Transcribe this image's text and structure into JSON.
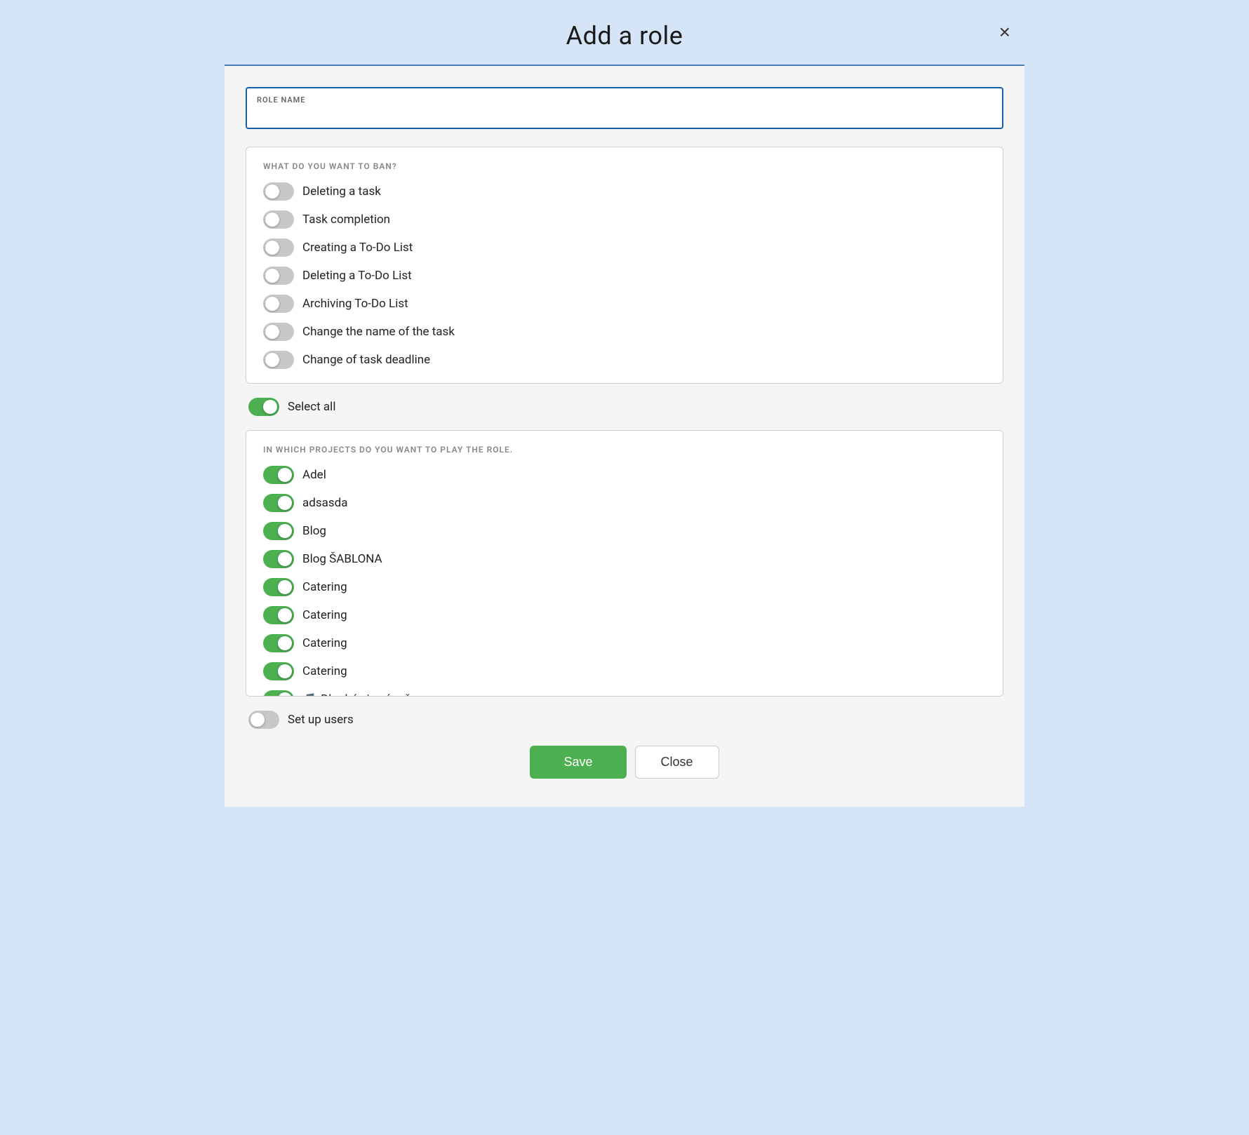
{
  "modal": {
    "title": "Add a role",
    "close_label": "×"
  },
  "role_name": {
    "label": "ROLE NAME",
    "placeholder": "",
    "value": ""
  },
  "ban_section": {
    "title": "WHAT DO YOU WANT TO BAN?",
    "items": [
      {
        "id": "deleting-task",
        "label": "Deleting a task",
        "on": false
      },
      {
        "id": "task-completion",
        "label": "Task completion",
        "on": false
      },
      {
        "id": "creating-todolist",
        "label": "Creating a To-Do List",
        "on": false
      },
      {
        "id": "deleting-todolist",
        "label": "Deleting a To-Do List",
        "on": false
      },
      {
        "id": "archiving-todolist",
        "label": "Archiving To-Do List",
        "on": false
      },
      {
        "id": "change-task-name",
        "label": "Change the name of the task",
        "on": false
      },
      {
        "id": "change-task-deadline",
        "label": "Change of task deadline",
        "on": false
      }
    ]
  },
  "select_all": {
    "label": "Select all",
    "on": true
  },
  "projects_section": {
    "title": "IN WHICH PROJECTS DO YOU WANT TO PLAY THE ROLE.",
    "items": [
      {
        "id": "adel",
        "label": "Adel",
        "on": true,
        "emoji": ""
      },
      {
        "id": "adsasda",
        "label": "adsasda",
        "on": true,
        "emoji": ""
      },
      {
        "id": "blog",
        "label": "Blog",
        "on": true,
        "emoji": ""
      },
      {
        "id": "blog-sablona",
        "label": "Blog ŠABLONA",
        "on": true,
        "emoji": ""
      },
      {
        "id": "catering-1",
        "label": "Catering",
        "on": true,
        "emoji": ""
      },
      {
        "id": "catering-2",
        "label": "Catering",
        "on": true,
        "emoji": ""
      },
      {
        "id": "catering-3",
        "label": "Catering",
        "on": true,
        "emoji": ""
      },
      {
        "id": "catering-4",
        "label": "Catering",
        "on": true,
        "emoji": ""
      },
      {
        "id": "dlouhe-zimni-vecery",
        "label": "Dlouhé zimní večery",
        "on": true,
        "emoji": "🎵"
      }
    ]
  },
  "setup_users": {
    "label": "Set up users",
    "on": false
  },
  "footer": {
    "save_label": "Save",
    "close_label": "Close"
  }
}
